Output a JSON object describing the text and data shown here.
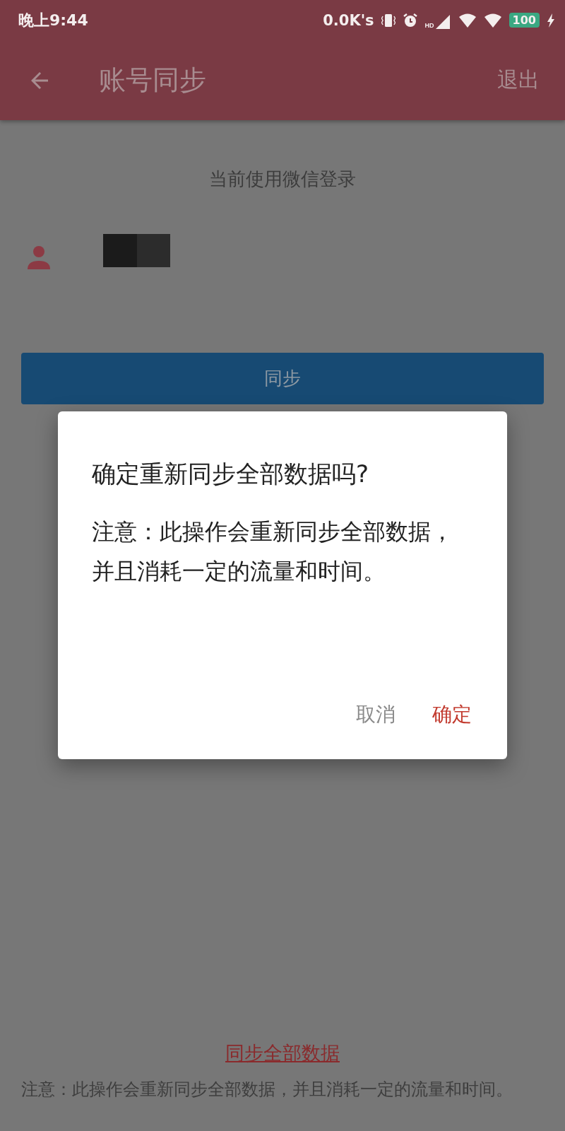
{
  "status_bar": {
    "time": "晚上9:44",
    "net_speed": "0.0K's",
    "battery": "100",
    "signal_label": "HD"
  },
  "app_bar": {
    "title": "账号同步",
    "action": "退出"
  },
  "login_notice": "当前使用微信登录",
  "account": {
    "name_redacted": true
  },
  "sync_button": "同步",
  "dialog": {
    "title": "确定重新同步全部数据吗?",
    "message": "注意：此操作会重新同步全部数据，并且消耗一定的流量和时间。",
    "buttons": [
      {
        "label": "取消",
        "kind": "neutral"
      },
      {
        "label": "确定",
        "kind": "positive"
      }
    ]
  },
  "sync_all_link": "同步全部数据",
  "footer_note": "注意：此操作会重新同步全部数据，并且消耗一定的流量和时间。"
}
